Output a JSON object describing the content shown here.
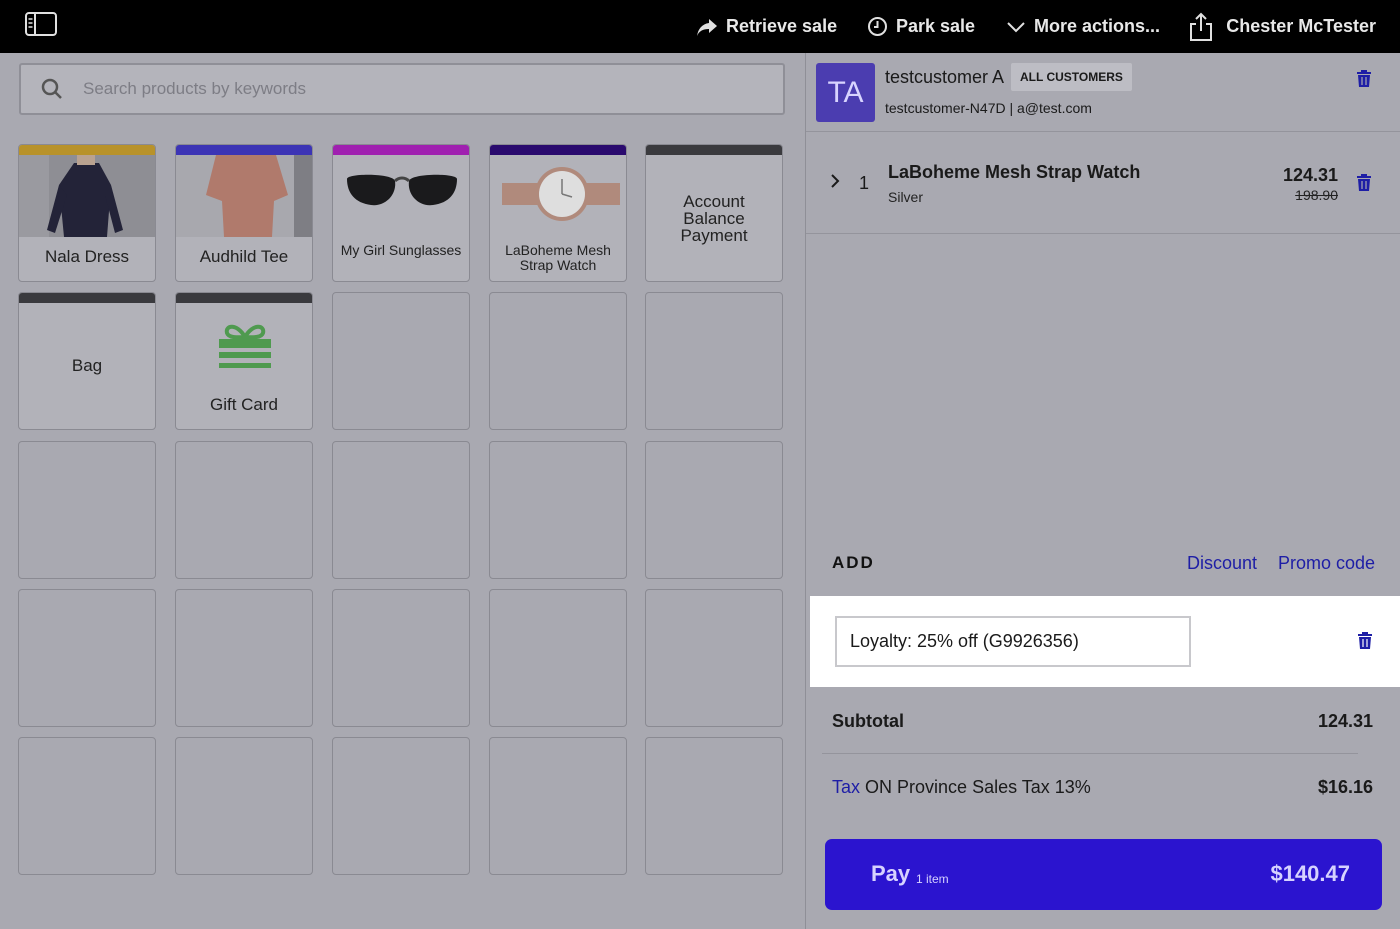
{
  "topbar": {
    "retrieve_sale": "Retrieve sale",
    "park_sale": "Park sale",
    "more_actions": "More actions...",
    "user": "Chester McTester"
  },
  "search": {
    "placeholder": "Search products by keywords"
  },
  "tiles": [
    {
      "label": "Nala Dress",
      "color": "#b8922a"
    },
    {
      "label": "Audhild Tee",
      "color": "#3c34b5"
    },
    {
      "label": "My Girl Sunglasses",
      "color": "#a020b0"
    },
    {
      "label": "LaBoheme Mesh Strap Watch",
      "color": "#2a0a6e"
    },
    {
      "label": "Account Balance Payment",
      "color": "#3a3a3e"
    },
    {
      "label": "Bag",
      "color": "#3a3a3e"
    },
    {
      "label": "Gift Card",
      "color": "#3a3a3e"
    }
  ],
  "customer": {
    "initials": "TA",
    "name": "testcustomer A",
    "group": "ALL CUSTOMERS",
    "code_email": "testcustomer-N47D | a@test.com"
  },
  "line_item": {
    "qty": "1",
    "name": "LaBoheme Mesh Strap Watch",
    "variant": "Silver",
    "price": "124.31",
    "original_price": "198.90"
  },
  "add": {
    "title": "ADD",
    "discount": "Discount",
    "promo": "Promo code"
  },
  "loyalty": {
    "text": "Loyalty: 25% off (G9926356)"
  },
  "summary": {
    "subtotal_label": "Subtotal",
    "subtotal_value": "124.31",
    "tax_link": "Tax",
    "tax_label": "ON Province Sales Tax 13%",
    "tax_value": "$16.16"
  },
  "pay": {
    "label": "Pay",
    "count": "1 item",
    "total": "$140.47"
  },
  "colors": {
    "accent": "#2b14cf",
    "link": "#1e1ea6",
    "avatar": "#4b3db0"
  }
}
